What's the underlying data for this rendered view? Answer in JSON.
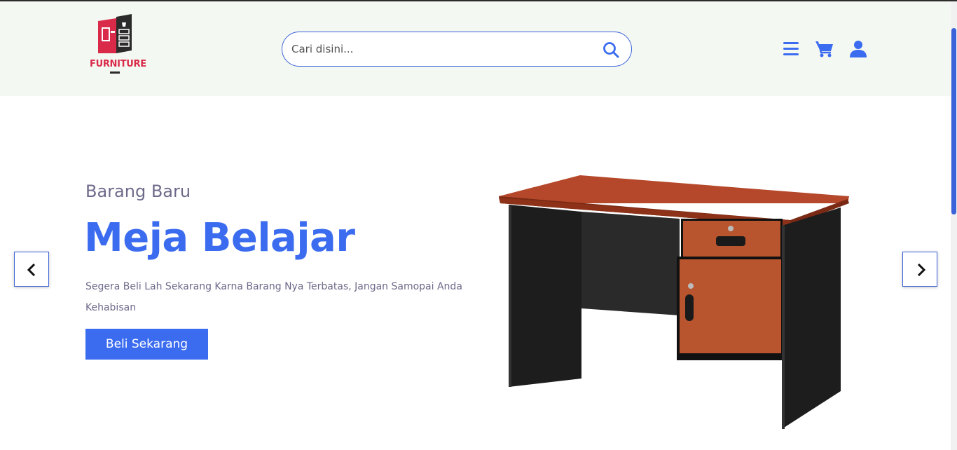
{
  "brand": {
    "logo_text": "FURNITURE",
    "icon": "furniture-logo"
  },
  "search": {
    "placeholder": "Cari disini...",
    "value": "",
    "icon": "search-icon"
  },
  "header_icons": [
    "menu-icon",
    "cart-icon",
    "user-icon"
  ],
  "hero": {
    "eyebrow": "Barang Baru",
    "title": "Meja Belajar",
    "description": "Segera Beli Lah Sekarang Karna Barang Nya Terbatas, Jangan Samopai Anda Kehabisan",
    "cta_label": "Beli Sekarang",
    "image": "study-desk"
  },
  "carousel": {
    "prev_icon": "chevron-left-icon",
    "next_icon": "chevron-right-icon"
  },
  "colors": {
    "accent": "#3b6cf0",
    "header_bg": "#f4f8f2",
    "text_muted": "#6e6a8a",
    "logo_red": "#d92a4a"
  }
}
